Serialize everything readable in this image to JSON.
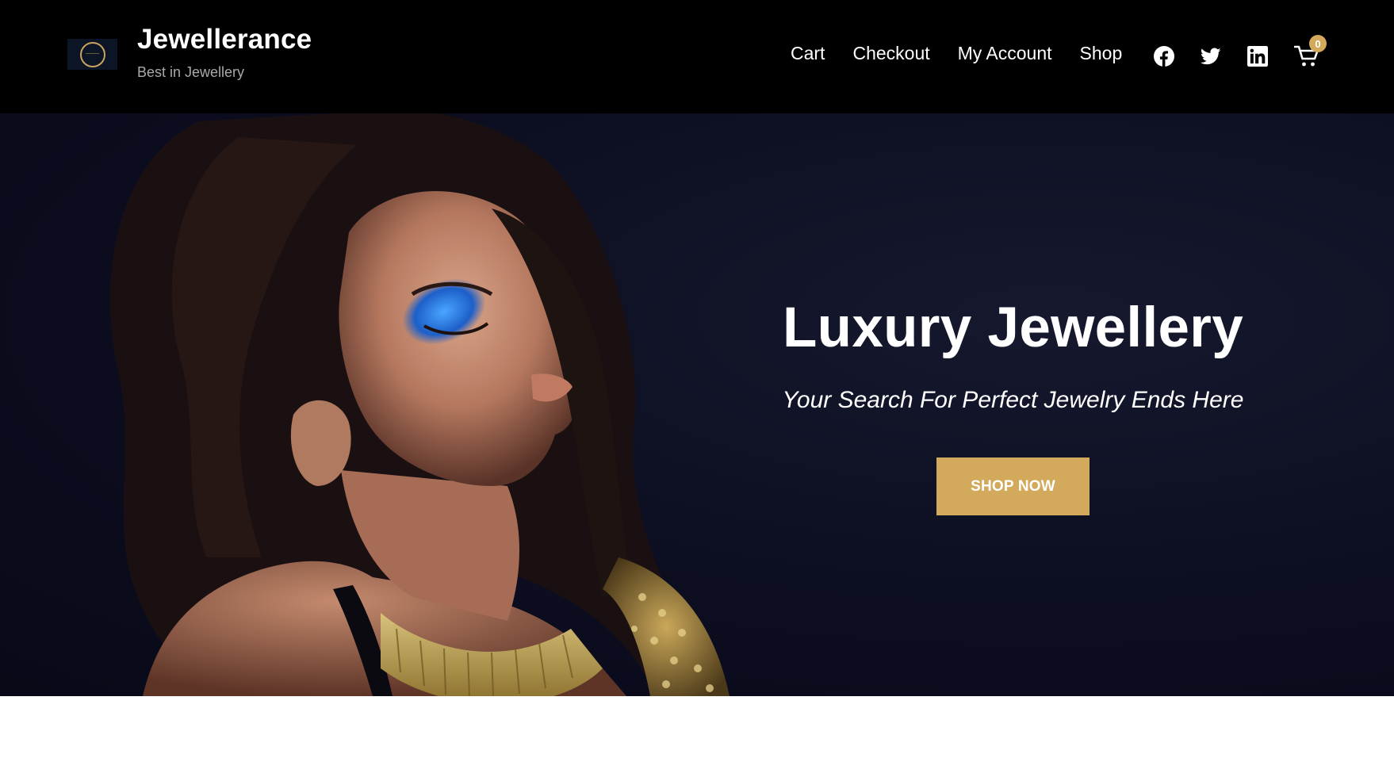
{
  "header": {
    "site_title": "Jewellerance",
    "tagline": "Best in Jewellery",
    "logo_icon": "gold-ring-icon",
    "nav": [
      {
        "label": "Cart"
      },
      {
        "label": "Checkout"
      },
      {
        "label": "My Account"
      },
      {
        "label": "Shop"
      }
    ],
    "social": [
      {
        "icon": "facebook-icon"
      },
      {
        "icon": "twitter-icon"
      },
      {
        "icon": "linkedin-icon"
      }
    ],
    "cart": {
      "icon": "shopping-cart-icon",
      "count": "0"
    }
  },
  "hero": {
    "title": "Luxury Jewellery",
    "subtitle": "Your Search For Perfect Jewelry Ends Here",
    "button_label": "SHOP NOW"
  },
  "colors": {
    "header_bg": "#000000",
    "accent_gold": "#d3aa5b",
    "hero_bg": "#0d0f22",
    "tagline": "#a9a9a9"
  }
}
